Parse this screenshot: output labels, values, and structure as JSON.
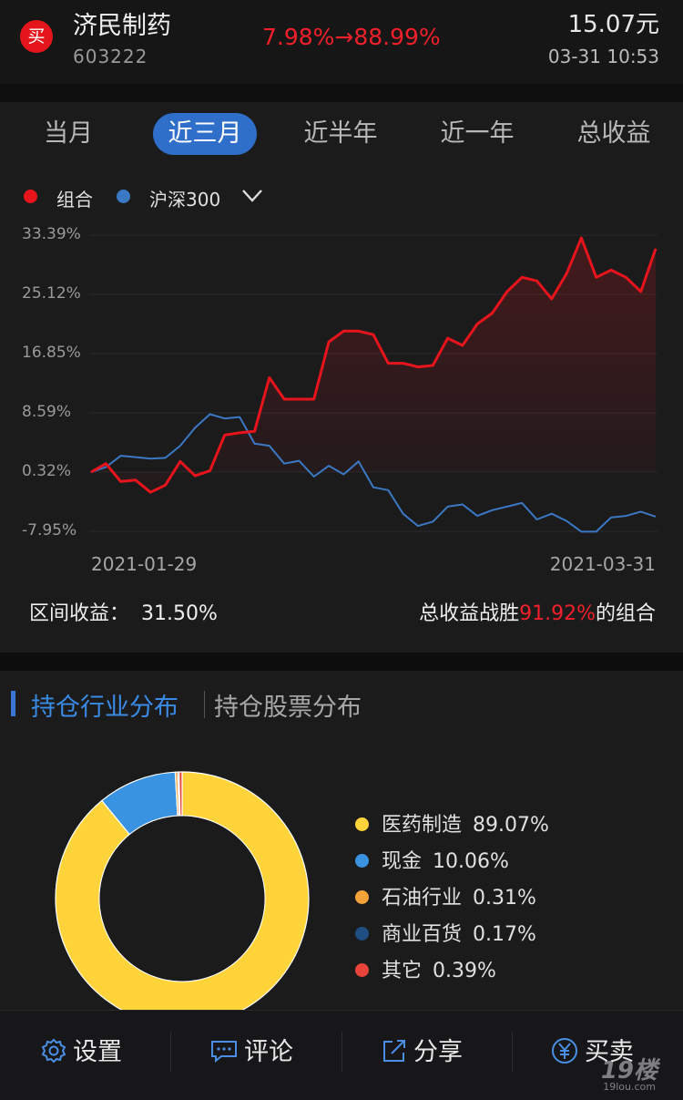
{
  "header": {
    "badge": "买",
    "name": "济民制药",
    "code": "603222",
    "change": "7.98%→88.99%",
    "price": "15.07元",
    "time": "03-31 10:53"
  },
  "tabs": [
    {
      "label": "当月",
      "active": false
    },
    {
      "label": "近三月",
      "active": true
    },
    {
      "label": "近半年",
      "active": false
    },
    {
      "label": "近一年",
      "active": false
    },
    {
      "label": "总收益",
      "active": false
    }
  ],
  "legend": {
    "portfolio": "组合",
    "benchmark": "沪深300",
    "portfolio_color": "#e8141c",
    "benchmark_color": "#3b78c4"
  },
  "chart_data": {
    "type": "line",
    "y_ticks": [
      "33.39%",
      "25.12%",
      "16.85%",
      "8.59%",
      "0.32%",
      "-7.95%"
    ],
    "ylim": [
      -7.95,
      33.39
    ],
    "x_labels": [
      "2021-01-29",
      "2021-03-31"
    ],
    "series": [
      {
        "name": "组合",
        "color": "#e8141c",
        "values": [
          0.3,
          1.5,
          -1.0,
          -0.8,
          -2.5,
          -1.5,
          1.8,
          -0.2,
          0.5,
          5.5,
          5.8,
          6.0,
          13.5,
          10.5,
          10.5,
          10.5,
          18.5,
          20.0,
          20.0,
          19.5,
          15.5,
          15.5,
          15.0,
          15.2,
          19.0,
          18.0,
          21.0,
          22.5,
          25.5,
          27.5,
          27.0,
          24.5,
          28.0,
          33.0,
          27.5,
          28.5,
          27.5,
          25.5,
          31.5
        ]
      },
      {
        "name": "沪深300",
        "color": "#3b78c4",
        "values": [
          0.3,
          1.0,
          2.6,
          2.4,
          2.2,
          2.3,
          4.0,
          6.5,
          8.4,
          7.8,
          8.0,
          4.3,
          4.0,
          1.5,
          1.9,
          -0.3,
          1.2,
          0.0,
          1.8,
          -1.8,
          -2.2,
          -5.5,
          -7.2,
          -6.6,
          -4.5,
          -4.2,
          -5.8,
          -5.0,
          -4.5,
          -4.0,
          -6.3,
          -5.5,
          -6.5,
          -8.0,
          -8.0,
          -6.0,
          -5.8,
          -5.2,
          -5.9
        ]
      }
    ]
  },
  "summary": {
    "label": "区间收益：",
    "value": "31.50%",
    "beat_prefix": "总收益战胜",
    "beat_value": "91.92%",
    "beat_suffix": "的组合"
  },
  "section_tabs": {
    "active": "持仓行业分布",
    "inactive": "持仓股票分布"
  },
  "pie": {
    "type": "pie",
    "slices": [
      {
        "name": "医药制造",
        "label": "89.07%",
        "value": 89.07,
        "color": "#ffd43b"
      },
      {
        "name": "现金",
        "label": "10.06%",
        "value": 10.06,
        "color": "#3a93e0"
      },
      {
        "name": "石油行业",
        "label": "0.31%",
        "value": 0.31,
        "color": "#f3a23a"
      },
      {
        "name": "商业百货",
        "label": "0.17%",
        "value": 0.17,
        "color": "#1f4f82"
      },
      {
        "name": "其它",
        "label": "0.39%",
        "value": 0.39,
        "color": "#e8443a"
      }
    ]
  },
  "nav": [
    {
      "label": "设置",
      "icon": "gear-icon"
    },
    {
      "label": "评论",
      "icon": "comment-icon"
    },
    {
      "label": "分享",
      "icon": "share-icon"
    },
    {
      "label": "买卖",
      "icon": "yen-icon"
    }
  ],
  "watermark": {
    "main": "19楼",
    "sub": "19lou.com"
  }
}
